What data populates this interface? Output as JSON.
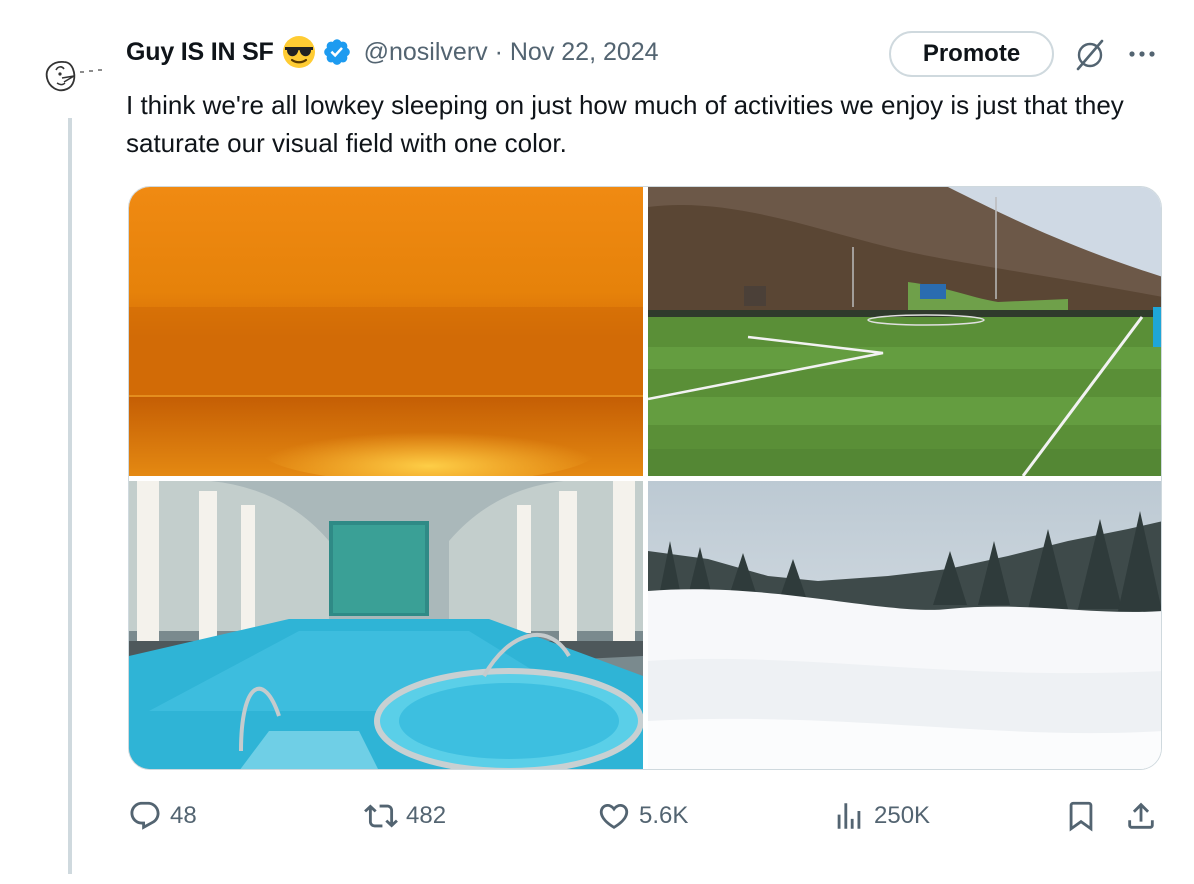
{
  "tweet": {
    "author_name": "Guy IS IN SF",
    "handle_date": "@nosilverv · Nov 22, 2024",
    "text": "I think we're all lowkey sleeping on just how much of activities we enjoy is just that they saturate our visual field with one color."
  },
  "header_actions": {
    "promote_label": "Promote",
    "grok_icon": "grok-icon",
    "more_icon": "more-dots-icon"
  },
  "media": {
    "images": [
      {
        "subject": "orange sunset over sea",
        "dominant_color": "#e8830f"
      },
      {
        "subject": "green soccer field",
        "dominant_color": "#5e8f3a"
      },
      {
        "subject": "indoor swimming pool",
        "dominant_color": "#2fb4d6"
      },
      {
        "subject": "snowy pine forest",
        "dominant_color": "#f4f6f8"
      }
    ]
  },
  "actions": {
    "replies": "48",
    "reposts": "482",
    "likes": "5.6K",
    "views": "250K"
  },
  "colors": {
    "text": "#0f1419",
    "secondary": "#536471",
    "verified": "#1d9bf0",
    "border": "#cfd9de"
  }
}
